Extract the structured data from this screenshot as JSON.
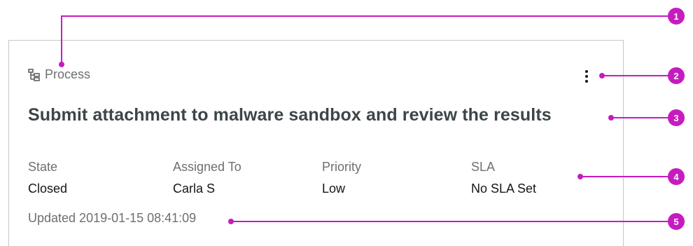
{
  "card": {
    "type_label": "Process",
    "type_icon": "process-tree-icon",
    "menu_icon": "overflow-menu-vertical-icon",
    "title": "Submit attachment to malware sandbox and review the results",
    "fields": [
      {
        "label": "State",
        "value": "Closed"
      },
      {
        "label": "Assigned To",
        "value": "Carla S"
      },
      {
        "label": "Priority",
        "value": "Low"
      },
      {
        "label": "SLA",
        "value": "No SLA Set"
      }
    ],
    "updated": "Updated 2019-01-15 08:41:09"
  },
  "callouts": {
    "color": "#c61cbf",
    "badges": [
      "1",
      "2",
      "3",
      "4",
      "5"
    ]
  }
}
